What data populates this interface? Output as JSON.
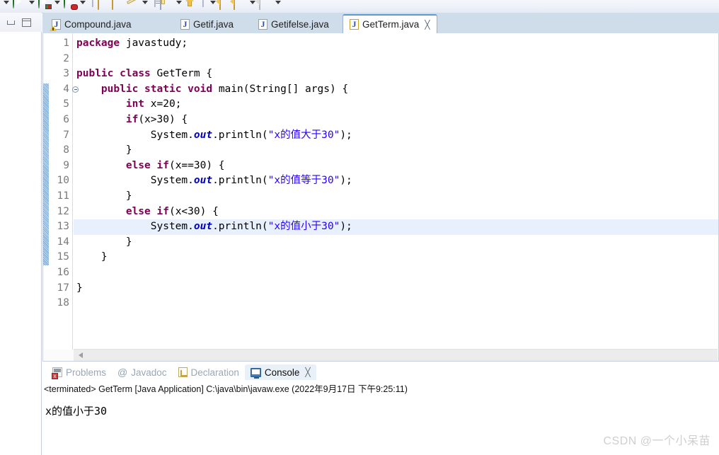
{
  "toolbar": {
    "items": [
      {
        "name": "run-dropdown-arrow",
        "kind": "arrow"
      },
      {
        "name": "run-button",
        "kind": "run"
      },
      {
        "name": "run-dropdown-arrow-2",
        "kind": "arrow"
      },
      {
        "name": "run-configurations-button",
        "kind": "run-rb"
      },
      {
        "name": "run-dropdown-arrow-3",
        "kind": "arrow"
      },
      {
        "name": "debug-button",
        "kind": "debug"
      },
      {
        "name": "debug-dropdown-arrow",
        "kind": "arrow"
      },
      {
        "name": "toolbar-separator-1",
        "kind": "sep"
      },
      {
        "name": "open-folder-button",
        "kind": "folder"
      },
      {
        "name": "new-folder-button",
        "kind": "folder"
      },
      {
        "name": "edit-button",
        "kind": "pencil"
      },
      {
        "name": "edit-dropdown-arrow",
        "kind": "arrow"
      },
      {
        "name": "toolbar-separator-2",
        "kind": "sep"
      },
      {
        "name": "task-list-button",
        "kind": "list"
      },
      {
        "name": "task-dropdown-arrow",
        "kind": "arrow"
      },
      {
        "name": "previous-annotation-button",
        "kind": "uparrow"
      },
      {
        "name": "toolbar-separator-3",
        "kind": "sep"
      },
      {
        "name": "back-dropdown-arrow",
        "kind": "arrow"
      },
      {
        "name": "back-button",
        "kind": "tag"
      },
      {
        "name": "forward-button",
        "kind": "tag"
      },
      {
        "name": "forward-dropdown-arrow",
        "kind": "arrow"
      },
      {
        "name": "next-button",
        "kind": "tag-gray"
      },
      {
        "name": "next-dropdown-arrow",
        "kind": "arrow"
      }
    ]
  },
  "left_pane": {
    "minimize_title": "Minimize",
    "maximize_title": "Maximize"
  },
  "editor": {
    "tabs": [
      {
        "label": "Compound.java",
        "active": false,
        "warning": true,
        "close": false
      },
      {
        "label": "Getif.java",
        "active": false,
        "warning": false,
        "close": false
      },
      {
        "label": "Getifelse.java",
        "active": false,
        "warning": false,
        "close": false
      },
      {
        "label": "GetTerm.java",
        "active": true,
        "warning": false,
        "close": true
      }
    ],
    "close_glyph": "╳",
    "line_numbers": [
      "1",
      "2",
      "3",
      "4",
      "5",
      "6",
      "7",
      "8",
      "9",
      "10",
      "11",
      "12",
      "13",
      "14",
      "15",
      "16",
      "17",
      "18"
    ],
    "fold_marker_line": 4,
    "highlighted_line": 13,
    "code_lines": [
      {
        "n": 1,
        "html": "<span class=\"kw\">package</span> javastudy;"
      },
      {
        "n": 2,
        "html": ""
      },
      {
        "n": 3,
        "html": "<span class=\"kw\">public</span> <span class=\"kw\">class</span> GetTerm {"
      },
      {
        "n": 4,
        "html": "    <span class=\"kw\">public</span> <span class=\"kw\">static</span> <span class=\"kw\">void</span> main(String[] args) {"
      },
      {
        "n": 5,
        "html": "        <span class=\"kw\">int</span> x=20;"
      },
      {
        "n": 6,
        "html": "        <span class=\"kw\">if</span>(x&gt;30) {"
      },
      {
        "n": 7,
        "html": "            System.<span class=\"fld\">out</span>.println(<span class=\"str\">\"x的值大于30\"</span>);"
      },
      {
        "n": 8,
        "html": "        }"
      },
      {
        "n": 9,
        "html": "        <span class=\"kw\">else</span> <span class=\"kw\">if</span>(x==30) {"
      },
      {
        "n": 10,
        "html": "            System.<span class=\"fld\">out</span>.println(<span class=\"str\">\"x的值等于30\"</span>);"
      },
      {
        "n": 11,
        "html": "        }"
      },
      {
        "n": 12,
        "html": "        <span class=\"kw\">else</span> <span class=\"kw\">if</span>(x&lt;30) {"
      },
      {
        "n": 13,
        "html": "            System.<span class=\"fld\">out</span>.println(<span class=\"str\">\"x的值小于30\"</span>);"
      },
      {
        "n": 14,
        "html": "        }"
      },
      {
        "n": 15,
        "html": "    }"
      },
      {
        "n": 16,
        "html": ""
      },
      {
        "n": 17,
        "html": "}"
      },
      {
        "n": 18,
        "html": ""
      }
    ],
    "code_plain": [
      "package javastudy;",
      "",
      "public class GetTerm {",
      "    public static void main(String[] args) {",
      "        int x=20;",
      "        if(x>30) {",
      "            System.out.println(\"x的值大于30\");",
      "        }",
      "        else if(x==30) {",
      "            System.out.println(\"x的值等于30\");",
      "        }",
      "        else if(x<30) {",
      "            System.out.println(\"x的值小于30\");",
      "        }",
      "    }",
      "",
      "}",
      ""
    ]
  },
  "console_panel": {
    "tabs": [
      {
        "label": "Problems",
        "icon": "problems-icon",
        "active": false
      },
      {
        "label": "Javadoc",
        "icon": "javadoc-icon",
        "active": false
      },
      {
        "label": "Declaration",
        "icon": "declaration-icon",
        "active": false
      },
      {
        "label": "Console",
        "icon": "console-icon",
        "active": true
      }
    ],
    "close_glyph": "╳",
    "status_line": "<terminated> GetTerm [Java Application] C:\\java\\bin\\javaw.exe (2022年9月17日 下午9:25:11)",
    "output": "x的值小于30"
  },
  "watermark": {
    "text": "CSDN @一个小呆苗"
  },
  "colors": {
    "tabbar_bg": "#cfdcea",
    "active_tab_border": "#5e9ad1",
    "keyword": "#7f0055",
    "string": "#2a00ff",
    "field": "#0000c0",
    "line_number": "#7b7b7b",
    "highlight_line": "#e8f0fd",
    "fold_bar": "#6ea8d8",
    "watermark": "#cfcfcf"
  }
}
